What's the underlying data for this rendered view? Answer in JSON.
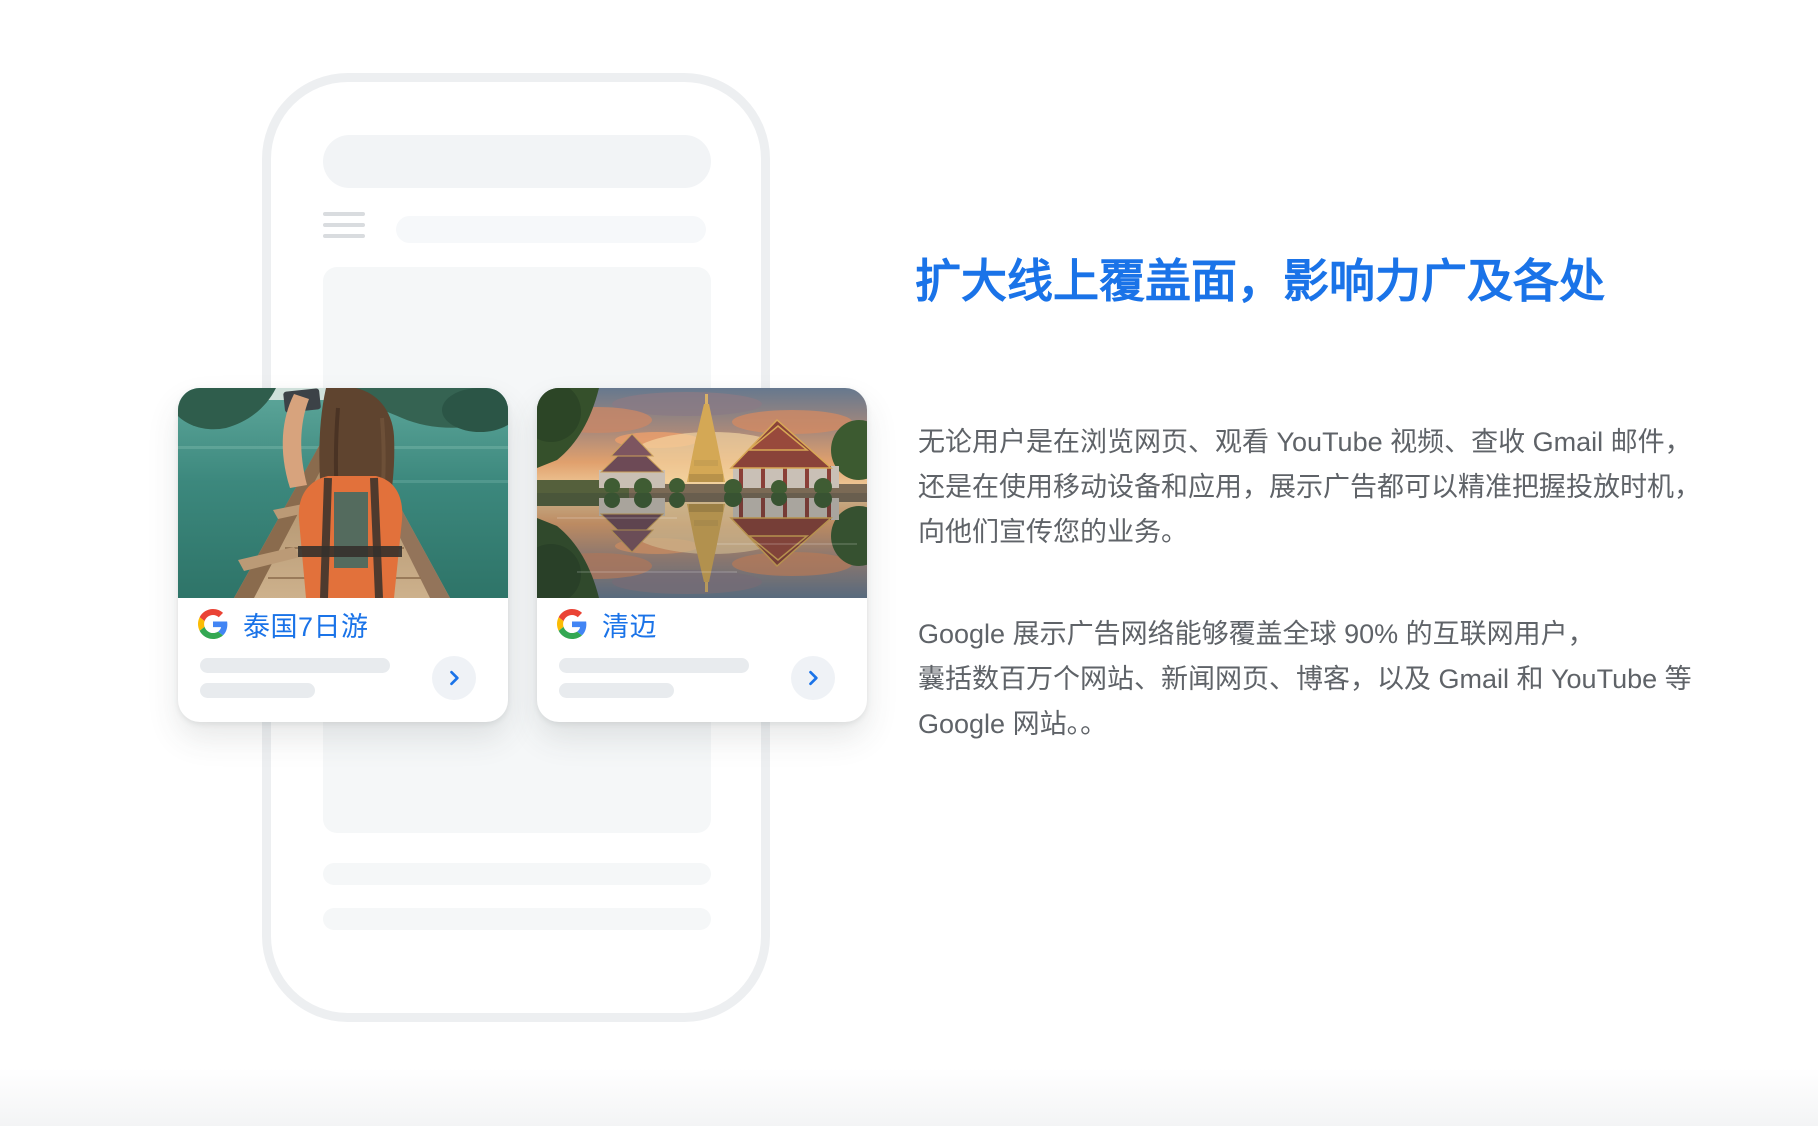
{
  "section": {
    "heading": "扩大线上覆盖面，影响力广及各处",
    "paragraph1": "无论用户是在浏览网页、观看 YouTube 视频、查收 Gmail 邮件，\n还是在使用移动设备和应用，展示广告都可以精准把握投放时机，\n向他们宣传您的业务。",
    "paragraph2": "Google 展示广告网络能够覆盖全球 90% 的互联网用户，\n囊括数百万个网站、新闻网页、博客，以及 Gmail 和 YouTube 等\nGoogle 网站。。"
  },
  "phone_mockup": {
    "menu_icon": "hamburger-menu-icon",
    "ad_cards": [
      {
        "label": "泰国7日游",
        "logo_icon": "google-g-icon",
        "action_icon": "chevron-right-icon",
        "photo": "thailand-longtail-boat-photo"
      },
      {
        "label": "清迈",
        "logo_icon": "google-g-icon",
        "action_icon": "chevron-right-icon",
        "photo": "chiang-mai-temple-reflection-photo"
      }
    ]
  },
  "colors": {
    "accent_blue": "#1a73e8",
    "body_text_gray": "#5f6368",
    "phone_border": "#edeff1",
    "skeleton_gray": "#f5f7f8",
    "google_red": "#ea4335",
    "google_yellow": "#fbbc05",
    "google_green": "#34a853",
    "google_blue": "#4285f4"
  }
}
